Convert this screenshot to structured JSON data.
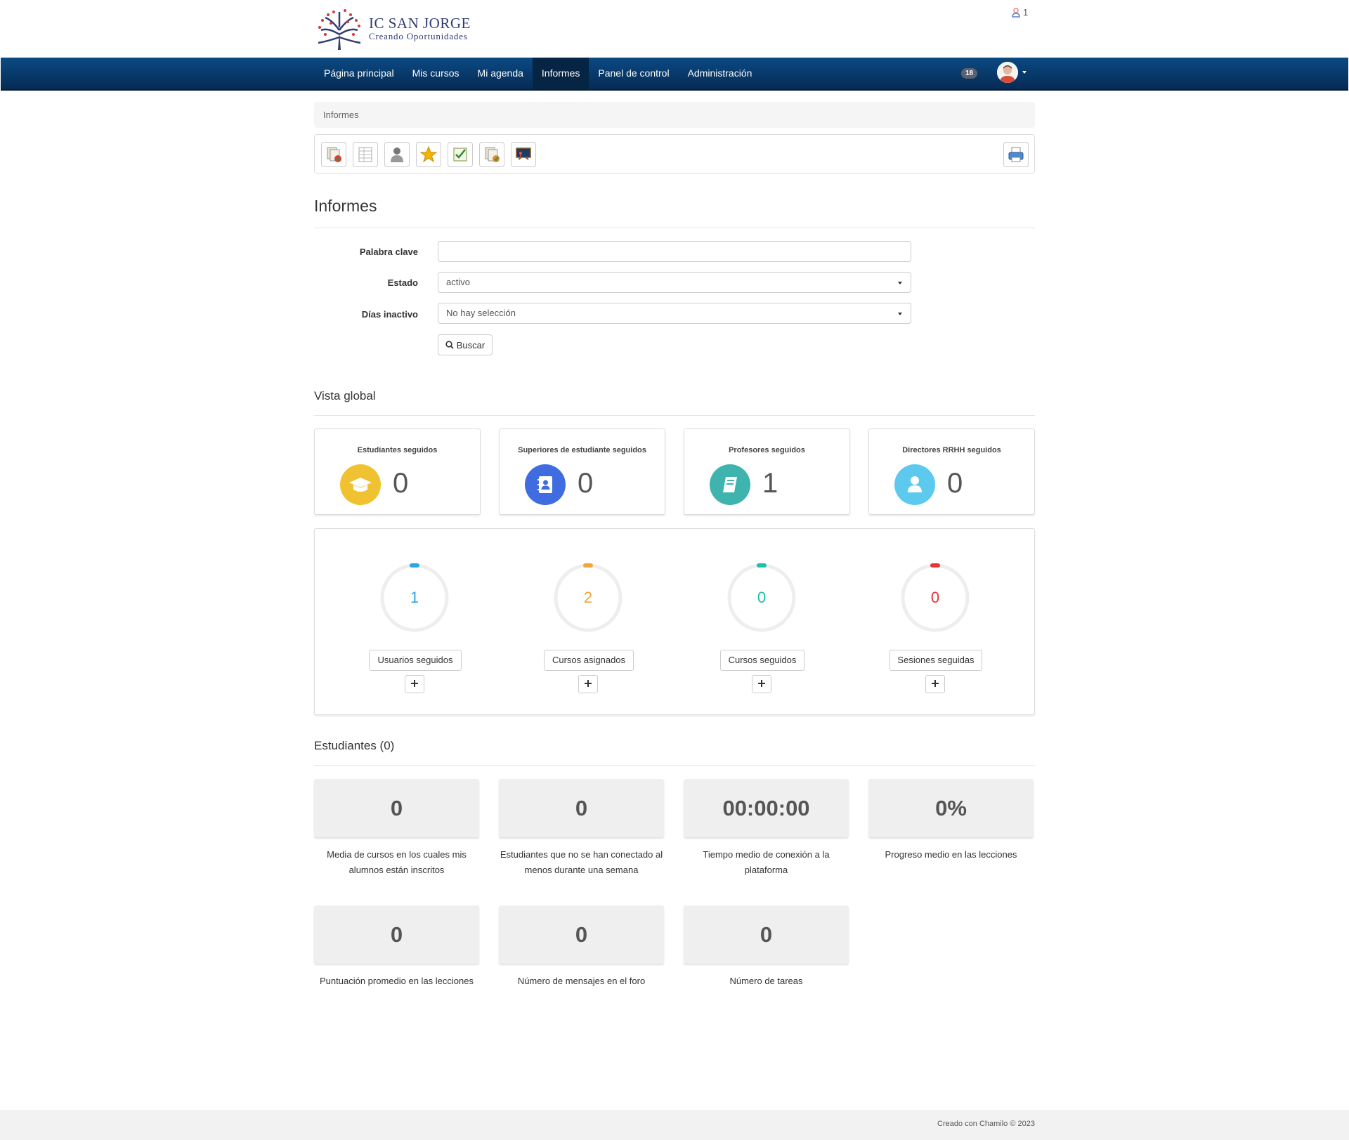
{
  "header": {
    "logo_title": "IC SAN JORGE",
    "logo_subtitle": "Creando Oportunidades",
    "online_count": "1"
  },
  "nav": {
    "items": [
      "Página principal",
      "Mis cursos",
      "Mi agenda",
      "Informes",
      "Panel de control",
      "Administración"
    ],
    "active": "Informes",
    "notifications": "18"
  },
  "breadcrumb": "Informes",
  "page_title": "Informes",
  "form": {
    "keyword_label": "Palabra clave",
    "keyword_value": "",
    "status_label": "Estado",
    "status_value": "activo",
    "inactive_label": "Días inactivo",
    "inactive_value": "No hay selección",
    "search_button": "Buscar"
  },
  "overview": {
    "title": "Vista global",
    "cards": [
      {
        "title": "Estudiantes seguidos",
        "value": "0",
        "icon": "graduation-cap-icon",
        "color": "#f0c231"
      },
      {
        "title": "Superiores de estudiante seguidos",
        "value": "0",
        "icon": "address-book-icon",
        "color": "#3f6ce0"
      },
      {
        "title": "Profesores seguidos",
        "value": "1",
        "icon": "book-icon",
        "color": "#3fb3ae"
      },
      {
        "title": "Directores RRHH seguidos",
        "value": "0",
        "icon": "user-icon",
        "color": "#5ec9ee"
      }
    ],
    "rings": [
      {
        "value": "1",
        "label": "Usuarios seguidos",
        "color": "#2ea6e0"
      },
      {
        "value": "2",
        "label": "Cursos asignados",
        "color": "#f3a43b"
      },
      {
        "value": "0",
        "label": "Cursos seguidos",
        "color": "#1fbfb0"
      },
      {
        "value": "0",
        "label": "Sesiones seguidas",
        "color": "#e8333c"
      }
    ]
  },
  "students": {
    "title": "Estudiantes (0)",
    "stats": [
      {
        "value": "0",
        "label": "Media de cursos en los cuales mis alumnos están inscritos"
      },
      {
        "value": "0",
        "label": "Estudiantes que no se han conectado al menos durante una semana"
      },
      {
        "value": "00:00:00",
        "label": "Tiempo medio de conexión a la plataforma"
      },
      {
        "value": "0%",
        "label": "Progreso medio en las lecciones"
      },
      {
        "value": "0",
        "label": "Puntuación promedio en las lecciones"
      },
      {
        "value": "0",
        "label": "Número de mensajes en el foro"
      },
      {
        "value": "0",
        "label": "Número de tareas"
      }
    ]
  },
  "footer": "Creado con Chamilo © 2023"
}
